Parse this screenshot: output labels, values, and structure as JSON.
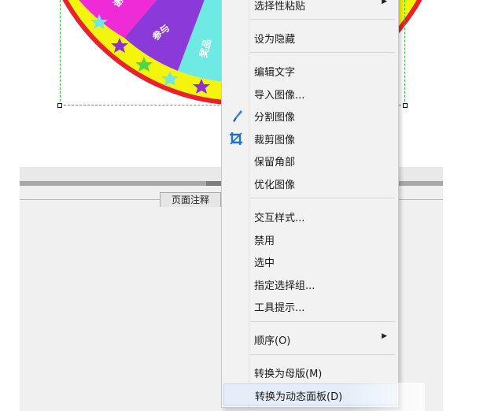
{
  "lower_panel": {
    "tab_label": "页面注释"
  },
  "wheel": {
    "colors": {
      "rim_red": "#e8212a",
      "rim_yellow": "#f5f40e",
      "segment_magenta": "#ee2bd7",
      "segment_purple": "#8b3ad9",
      "segment_cyan": "#6fe9e4",
      "star_purple": "#8e2fd6",
      "star_cyan": "#6ee7e5",
      "star_green": "#4fd64a"
    }
  },
  "selection": {
    "color": "#2fbf3f"
  },
  "context_menu": {
    "items": [
      {
        "label": "选择性粘贴",
        "submenu": true,
        "icon": ""
      },
      {
        "label": "设为隐藏",
        "submenu": false,
        "icon": ""
      },
      {
        "label": "编辑文字",
        "submenu": false,
        "icon": ""
      },
      {
        "label": "导入图像...",
        "submenu": false,
        "icon": ""
      },
      {
        "label": "分割图像",
        "submenu": false,
        "icon": "slice-knife-icon"
      },
      {
        "label": "裁剪图像",
        "submenu": false,
        "icon": "crop-icon"
      },
      {
        "label": "保留角部",
        "submenu": false,
        "icon": ""
      },
      {
        "label": "优化图像",
        "submenu": false,
        "icon": ""
      },
      {
        "label": "交互样式...",
        "submenu": false,
        "icon": ""
      },
      {
        "label": "禁用",
        "submenu": false,
        "icon": ""
      },
      {
        "label": "选中",
        "submenu": false,
        "icon": ""
      },
      {
        "label": "指定选择组...",
        "submenu": false,
        "icon": ""
      },
      {
        "label": "工具提示...",
        "submenu": false,
        "icon": ""
      },
      {
        "label": "顺序(O)",
        "submenu": true,
        "icon": ""
      },
      {
        "label": "转换为母版(M)",
        "submenu": false,
        "icon": ""
      },
      {
        "label": "转换为动态面板(D)",
        "submenu": false,
        "icon": "",
        "highlighted": true
      }
    ],
    "submenu_arrow": "▶",
    "highlight_color": "#e5eef8"
  }
}
